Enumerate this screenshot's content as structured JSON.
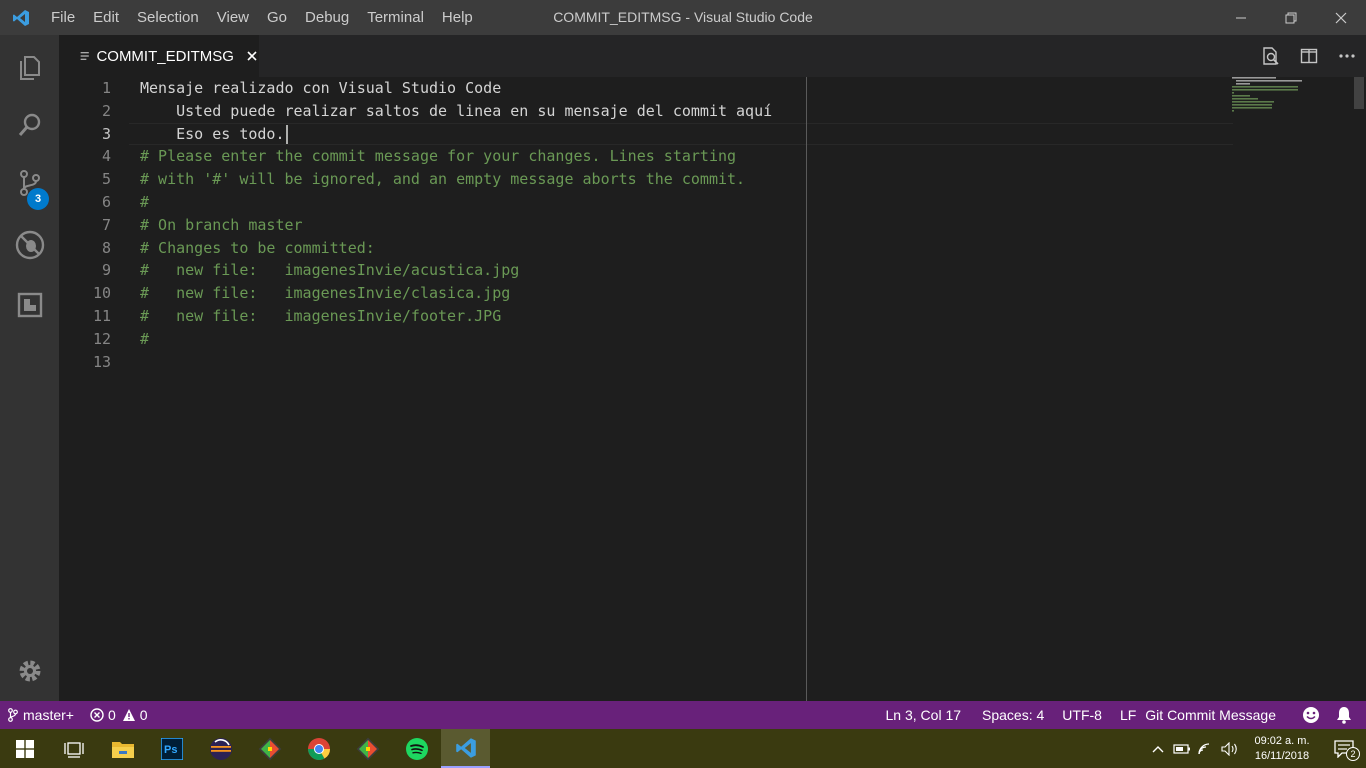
{
  "window": {
    "title": "COMMIT_EDITMSG - Visual Studio Code",
    "app_icon": "vscode-icon"
  },
  "menu": {
    "items": [
      "File",
      "Edit",
      "Selection",
      "View",
      "Go",
      "Debug",
      "Terminal",
      "Help"
    ]
  },
  "activity_bar": {
    "items": [
      "explorer-icon",
      "search-icon",
      "source-control-icon",
      "debug-icon",
      "extensions-icon"
    ],
    "source_control_badge": "3",
    "bottom": "settings-gear-icon"
  },
  "tabs": [
    {
      "label": "COMMIT_EDITMSG",
      "icon": "file-lines-icon",
      "active": true
    }
  ],
  "editor": {
    "line_numbers": [
      "1",
      "2",
      "3",
      "4",
      "5",
      "6",
      "7",
      "8",
      "9",
      "10",
      "11",
      "12",
      "13"
    ],
    "lines": [
      "Mensaje realizado con Visual Studio Code",
      "    Usted puede realizar saltos de linea en su mensaje del commit aquí",
      "    Eso es todo.",
      "# Please enter the commit message for your changes. Lines starting",
      "# with '#' will be ignored, and an empty message aborts the commit.",
      "#",
      "# On branch master",
      "# Changes to be committed:",
      "#   new file:   imagenesInvie/acustica.jpg",
      "#   new file:   imagenesInvie/clasica.jpg",
      "#   new file:   imagenesInvie/footer.JPG",
      "#",
      ""
    ],
    "current_line": 3
  },
  "statusbar": {
    "branch": "master+",
    "errors": "0",
    "warnings": "0",
    "position": "Ln 3, Col 17",
    "indent": "Spaces: 4",
    "encoding": "UTF-8",
    "eol": "LF",
    "language": "Git Commit Message",
    "bg_color": "#68217a"
  },
  "taskbar": {
    "apps": [
      "windows-start-icon",
      "task-view-icon",
      "file-explorer-icon",
      "photoshop-icon",
      "eclipse-icon",
      "git-icon",
      "chrome-icon",
      "git-gui-icon",
      "spotify-icon",
      "vscode-icon"
    ],
    "time": "09:02 a. m.",
    "date": "16/11/2018",
    "notifications": "2"
  }
}
